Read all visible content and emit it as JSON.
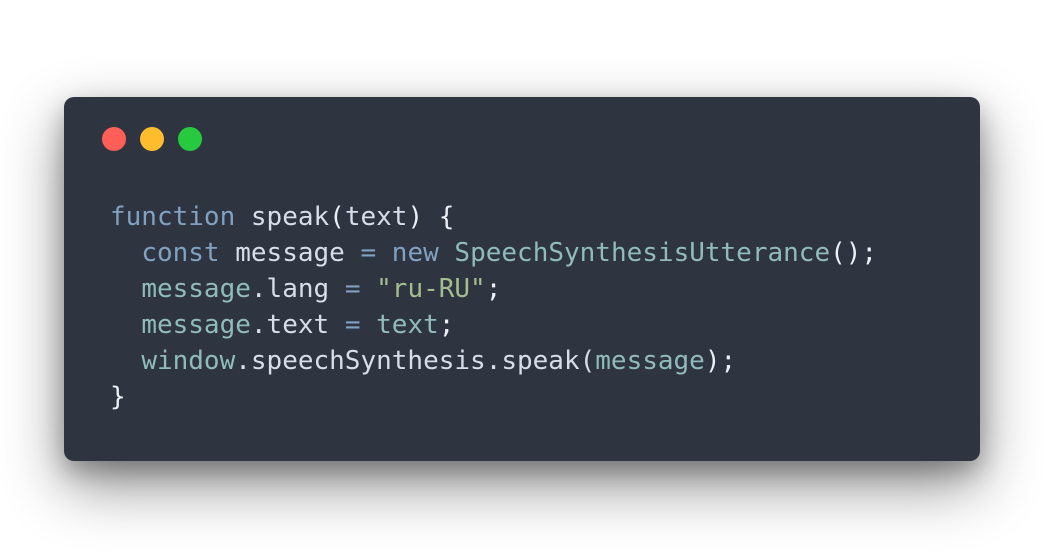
{
  "colors": {
    "window_bg": "#2f3441",
    "light_close": "#ff5f56",
    "light_minimize": "#ffbd2e",
    "light_maximize": "#27c93f"
  },
  "code": {
    "lines": [
      [
        {
          "t": "function",
          "c": "kw"
        },
        {
          "t": " ",
          "c": "id"
        },
        {
          "t": "speak",
          "c": "fn"
        },
        {
          "t": "(",
          "c": "punc"
        },
        {
          "t": "text",
          "c": "id"
        },
        {
          "t": ") {",
          "c": "punc"
        }
      ],
      [
        {
          "t": "  ",
          "c": "id"
        },
        {
          "t": "const",
          "c": "kw"
        },
        {
          "t": " ",
          "c": "id"
        },
        {
          "t": "message",
          "c": "id"
        },
        {
          "t": " ",
          "c": "id"
        },
        {
          "t": "=",
          "c": "op"
        },
        {
          "t": " ",
          "c": "id"
        },
        {
          "t": "new",
          "c": "kw"
        },
        {
          "t": " ",
          "c": "id"
        },
        {
          "t": "SpeechSynthesisUtterance",
          "c": "cls"
        },
        {
          "t": "();",
          "c": "punc"
        }
      ],
      [
        {
          "t": "  ",
          "c": "id"
        },
        {
          "t": "message",
          "c": "var"
        },
        {
          "t": ".lang",
          "c": "id"
        },
        {
          "t": " ",
          "c": "id"
        },
        {
          "t": "=",
          "c": "op"
        },
        {
          "t": " ",
          "c": "id"
        },
        {
          "t": "\"ru-RU\"",
          "c": "str"
        },
        {
          "t": ";",
          "c": "punc"
        }
      ],
      [
        {
          "t": "  ",
          "c": "id"
        },
        {
          "t": "message",
          "c": "var"
        },
        {
          "t": ".text",
          "c": "id"
        },
        {
          "t": " ",
          "c": "id"
        },
        {
          "t": "=",
          "c": "op"
        },
        {
          "t": " ",
          "c": "id"
        },
        {
          "t": "text",
          "c": "var"
        },
        {
          "t": ";",
          "c": "punc"
        }
      ],
      [
        {
          "t": "  ",
          "c": "id"
        },
        {
          "t": "window",
          "c": "var"
        },
        {
          "t": ".speechSynthesis.speak(",
          "c": "id"
        },
        {
          "t": "message",
          "c": "var"
        },
        {
          "t": ");",
          "c": "punc"
        }
      ],
      [
        {
          "t": "}",
          "c": "punc"
        }
      ]
    ]
  }
}
